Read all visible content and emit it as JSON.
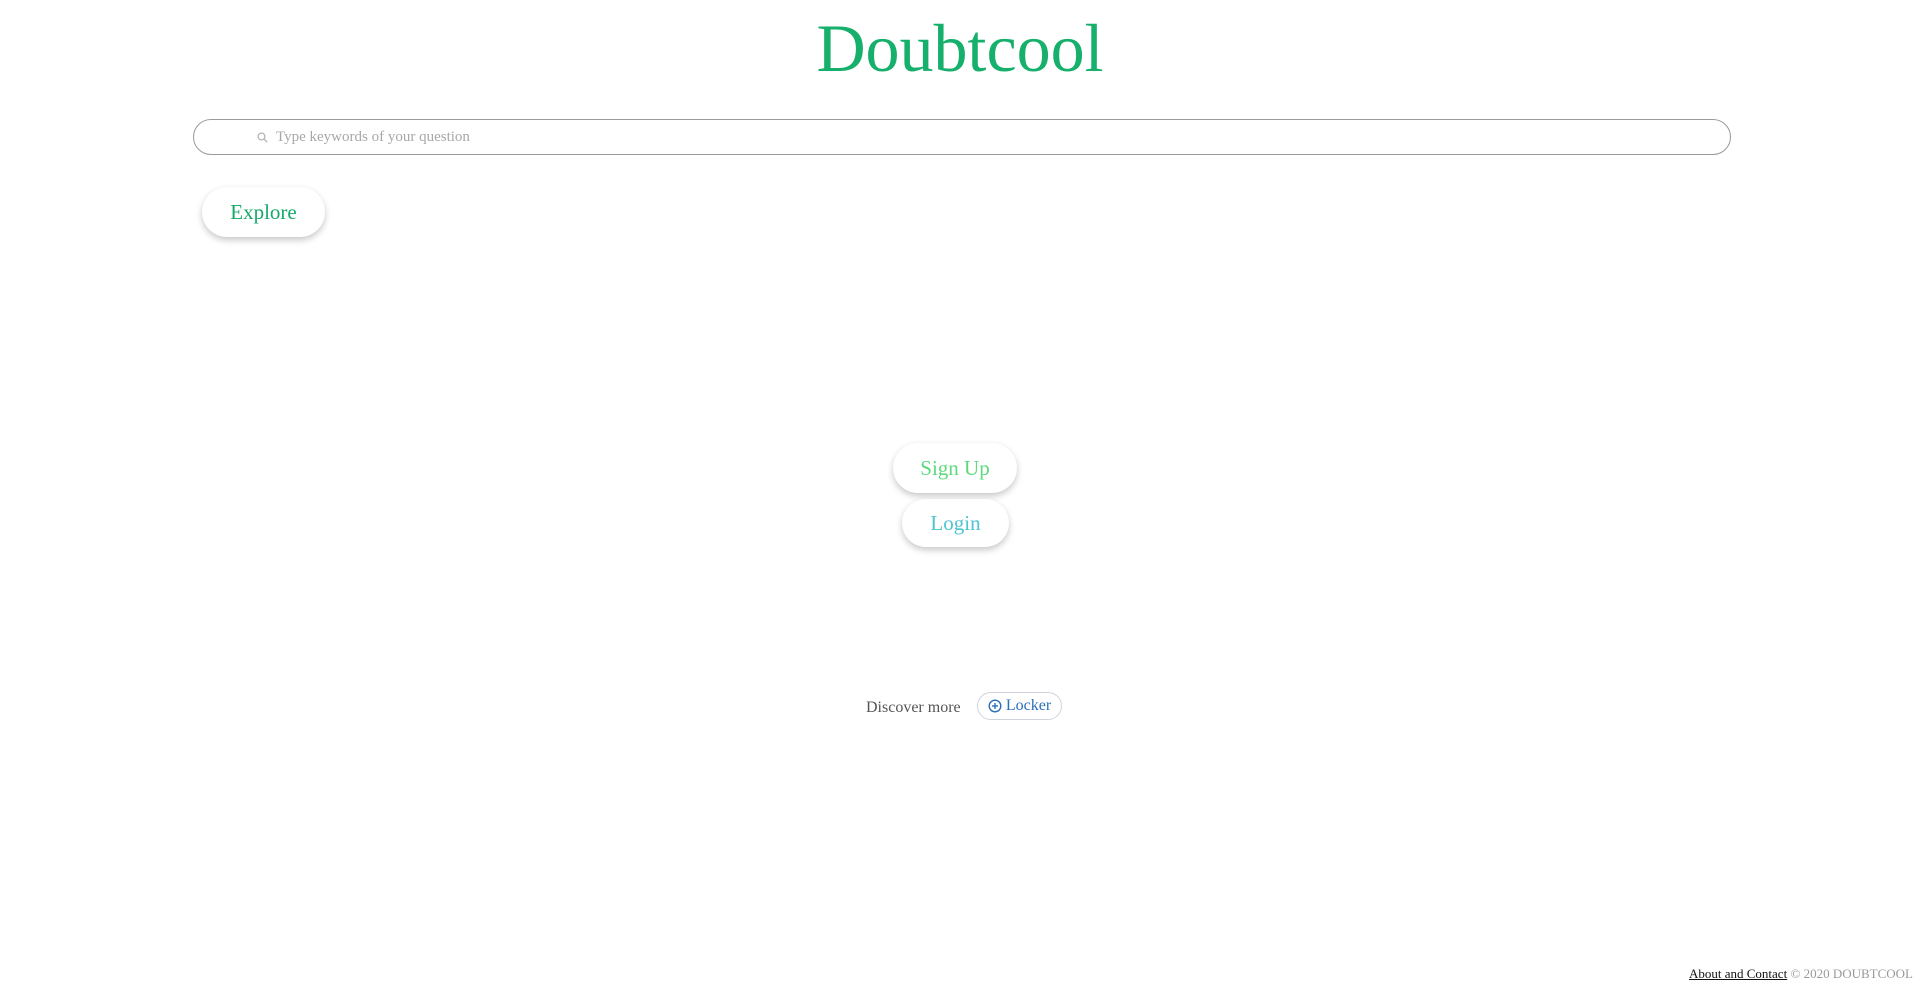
{
  "header": {
    "logo_text": "Doubtcool"
  },
  "search": {
    "placeholder": "Type keywords of your question",
    "value": "",
    "icon": "search-icon"
  },
  "explore": {
    "label": "Explore"
  },
  "auth": {
    "signup_label": "Sign Up",
    "login_label": "Login"
  },
  "discover": {
    "label": "Discover more",
    "locker_label": "Locker",
    "locker_icon": "plus-circle-icon"
  },
  "footer": {
    "about_link": "About and Contact",
    "copyright": "© 2020 DOUBTCOOL"
  },
  "colors": {
    "brand_green": "#16b06c",
    "signup_green": "#5ed97d",
    "login_teal": "#4cc5d0",
    "locker_blue": "#2a6fb8"
  }
}
